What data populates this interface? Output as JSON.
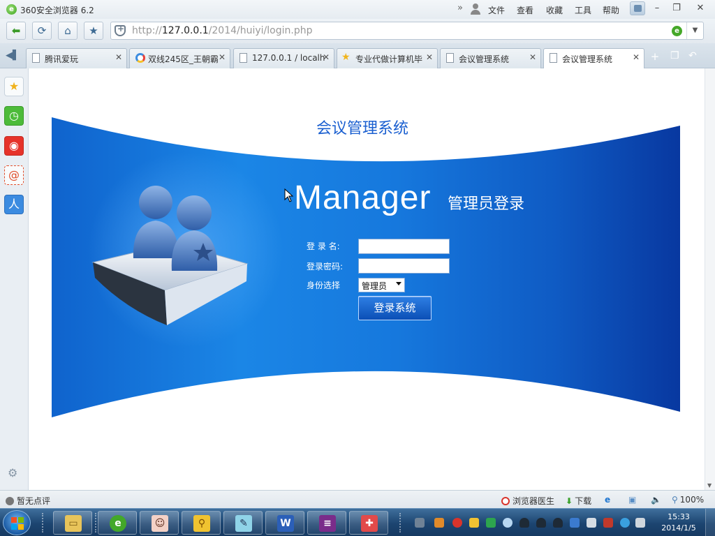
{
  "browser": {
    "title": "360安全浏览器 6.2",
    "menu": [
      "文件",
      "查看",
      "收藏",
      "工具",
      "帮助"
    ],
    "window_buttons": {
      "minimize": "–",
      "restore": "❐",
      "close": "✕"
    }
  },
  "address_bar": {
    "scheme": "http://",
    "host": "127.0.0.1",
    "path": "/2014/huiyi/login.php"
  },
  "tabs": [
    {
      "label": "腾讯爱玩",
      "icon": "page",
      "active": false
    },
    {
      "label": "双线245区_王朝霸",
      "icon": "ring",
      "active": false
    },
    {
      "label": "127.0.0.1 / localh",
      "icon": "page",
      "active": false
    },
    {
      "label": "专业代做计算机毕",
      "icon": "star",
      "active": false
    },
    {
      "label": "会议管理系统",
      "icon": "page",
      "active": false
    },
    {
      "label": "会议管理系统",
      "icon": "page",
      "active": true
    }
  ],
  "page": {
    "system_title": "会议管理系统",
    "hero_word": "Manager",
    "hero_subtitle": "管理员登录",
    "form": {
      "username_label": "登 录 名:",
      "username_value": "",
      "password_label": "登录密码:",
      "password_value": "",
      "role_label": "身份选择",
      "role_selected": "管理员",
      "submit_label": "登录系统"
    },
    "colors": {
      "banner_dark": "#0a40a6",
      "banner_light": "#1b86e6",
      "title_blue": "#1a5fd0"
    }
  },
  "status_bar": {
    "rating": "暂无点评",
    "doctor": "浏览器医生",
    "download": "下载",
    "zoom": "100%"
  },
  "taskbar": {
    "time": "15:33",
    "date": "2014/1/5"
  }
}
